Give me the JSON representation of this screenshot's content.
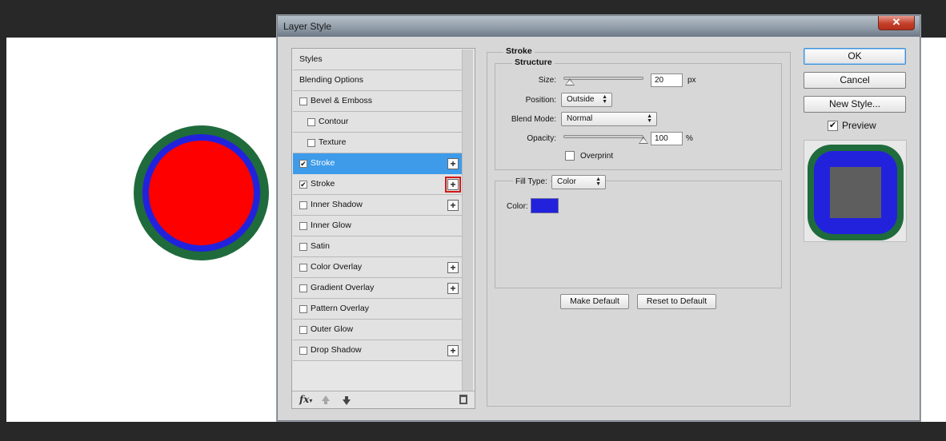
{
  "dialog": {
    "title": "Layer Style",
    "close_glyph": "✕"
  },
  "styles_panel": {
    "items": [
      {
        "label": "Styles",
        "kind": "header",
        "checked": false,
        "has_plus": false
      },
      {
        "label": "Blending Options",
        "kind": "header",
        "checked": false,
        "has_plus": false
      },
      {
        "label": "Bevel & Emboss",
        "kind": "check",
        "checked": false,
        "has_plus": false
      },
      {
        "label": "Contour",
        "kind": "sub",
        "checked": false,
        "has_plus": false
      },
      {
        "label": "Texture",
        "kind": "sub",
        "checked": false,
        "has_plus": false
      },
      {
        "label": "Stroke",
        "kind": "check",
        "checked": true,
        "has_plus": true,
        "selected": true
      },
      {
        "label": "Stroke",
        "kind": "check",
        "checked": true,
        "has_plus": true,
        "highlighted_plus": true
      },
      {
        "label": "Inner Shadow",
        "kind": "check",
        "checked": false,
        "has_plus": true
      },
      {
        "label": "Inner Glow",
        "kind": "check",
        "checked": false,
        "has_plus": false
      },
      {
        "label": "Satin",
        "kind": "check",
        "checked": false,
        "has_plus": false
      },
      {
        "label": "Color Overlay",
        "kind": "check",
        "checked": false,
        "has_plus": true
      },
      {
        "label": "Gradient Overlay",
        "kind": "check",
        "checked": false,
        "has_plus": true
      },
      {
        "label": "Pattern Overlay",
        "kind": "check",
        "checked": false,
        "has_plus": false
      },
      {
        "label": "Outer Glow",
        "kind": "check",
        "checked": false,
        "has_plus": false
      },
      {
        "label": "Drop Shadow",
        "kind": "check",
        "checked": false,
        "has_plus": true
      }
    ],
    "footer": {
      "fx_label": "fx",
      "icons": [
        "fx-icon",
        "move-up-icon",
        "move-down-icon",
        "trash-icon"
      ]
    }
  },
  "stroke": {
    "section_title": "Stroke",
    "structure_title": "Structure",
    "size_label": "Size:",
    "size_value": "20",
    "size_unit": "px",
    "size_slider_level": 0.08,
    "position_label": "Position:",
    "position_value": "Outside",
    "blend_label": "Blend Mode:",
    "blend_value": "Normal",
    "opacity_label": "Opacity:",
    "opacity_value": "100",
    "opacity_unit": "%",
    "opacity_slider_level": 1.0,
    "overprint_label": "Overprint",
    "overprint_checked": false,
    "fill_type_label": "Fill Type:",
    "fill_type_value": "Color",
    "color_label": "Color:",
    "color_hex": "#2222dd",
    "make_default": "Make Default",
    "reset_default": "Reset to Default"
  },
  "buttons": {
    "ok": "OK",
    "cancel": "Cancel",
    "new_style": "New Style..."
  },
  "preview": {
    "label": "Preview",
    "checked": true
  },
  "canvas": {
    "fill_color": "#ff0000",
    "stroke_inner_color": "#2222dd",
    "stroke_outer_color": "#1f6b3c"
  },
  "glyphs": {
    "check": "✔",
    "plus": "+",
    "dropdown": "▲▼"
  }
}
